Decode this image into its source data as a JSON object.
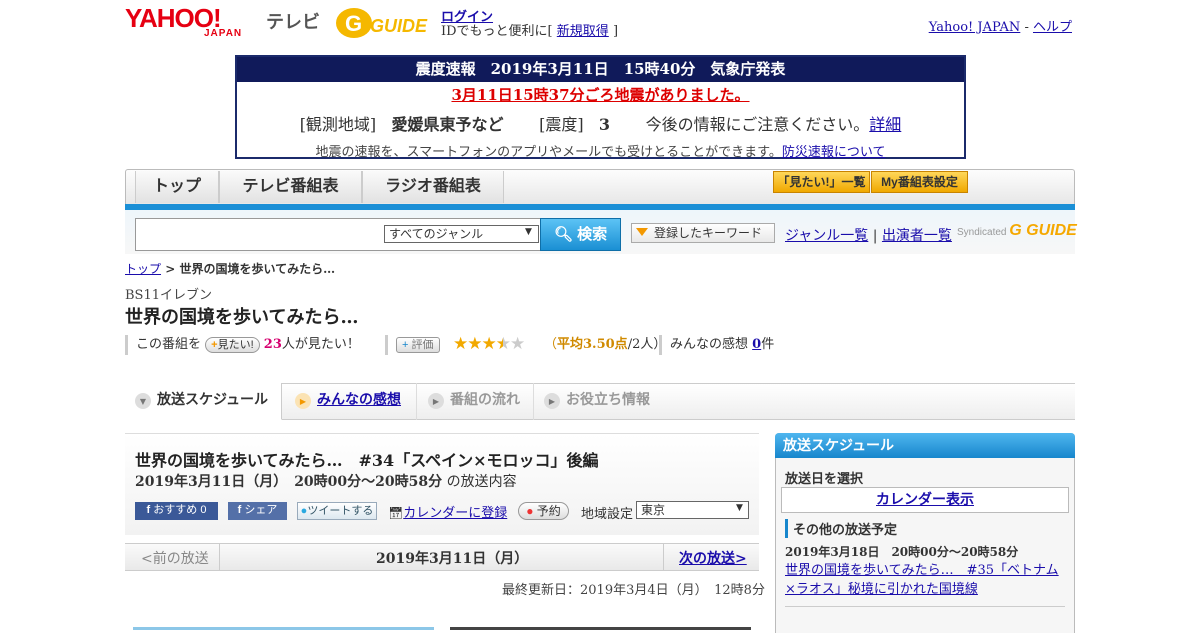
{
  "header": {
    "logo_text": "YAHOO!",
    "logo_sub": "JAPAN",
    "tv_label": "テレビ",
    "gguide_logo": "G GUIDE",
    "login": "ログイン",
    "id_text": "IDでもっと便利に[",
    "signup": "新規取得",
    "id_close": "]",
    "yahoo_japan_link": "Yahoo! JAPAN",
    "sep": " - ",
    "help": "ヘルプ"
  },
  "earthquake": {
    "headline": "震度速報　2019年3月11日　15時40分　気象庁発表",
    "alert": "3月11日15時37分ごろ地震がありました。",
    "region_label": "[観測地域]",
    "region": "愛媛県東予など",
    "intensity_label": "[震度]",
    "intensity": "3",
    "notice": "今後の情報にご注意ください。",
    "detail_link": "詳細",
    "note": "地震の速報を、スマートフォンのアプリやメールでも受けとることができます。",
    "note_link": "防災速報について"
  },
  "nav": {
    "tabs": [
      "トップ",
      "テレビ番組表",
      "ラジオ番組表"
    ],
    "want_list": "「見たい!」一覧",
    "my_schedule": "My番組表設定"
  },
  "search": {
    "genre_selected": "すべてのジャンル",
    "search_button": "検索",
    "keyword_button": "登録したキーワード",
    "genre_list": "ジャンル一覧",
    "divider": "|",
    "performer_list": "出演者一覧",
    "syndicated": "Syndicated",
    "syndicated_logo": "G GUIDE"
  },
  "breadcrumb": {
    "top": "トップ",
    "sep": " > ",
    "current": "世界の国境を歩いてみたら…"
  },
  "program": {
    "channel": "BS11イレブン",
    "title": "世界の国境を歩いてみたら…",
    "prefix": "この番組を",
    "want_button": "見たい!",
    "want_count": "23",
    "want_suffix": "人が見たい！",
    "rate_button": "評価",
    "stars": "★★★★★",
    "avg_open": "（",
    "avg": "平均3.50点",
    "avg_people": "/2人）",
    "opinion_label": "みんなの感想",
    "opinion_count": "0",
    "opinion_unit": "件"
  },
  "tabs": [
    {
      "label": "放送スケジュール"
    },
    {
      "label": "みんなの感想"
    },
    {
      "label": "番組の流れ"
    },
    {
      "label": "お役立ち情報"
    }
  ],
  "episode": {
    "title": "世界の国境を歩いてみたら…　#34「スペイン×モロッコ」後編",
    "datetime": "2019年3月11日（月）　20時00分～20時58分",
    "datetime_suffix": "の放送内容",
    "recommend": "おすすめ 0",
    "share": "シェア",
    "tweet": "ツイートする",
    "calendar": "カレンダーに登録",
    "reserve": "予約",
    "region_label": "地域設定",
    "region": "東京"
  },
  "pager": {
    "prev": "<前の放送",
    "date": "2019年3月11日（月）",
    "next": "次の放送>"
  },
  "updated": "最終更新日：2019年3月4日（月）　12時8分",
  "side": {
    "header": "放送スケジュール",
    "select_date": "放送日を選択",
    "calendar": "カレンダー表示",
    "other": "その他の放送予定",
    "next_date": "2019年3月18日　20時00分～20時58分",
    "next_prog": "世界の国境を歩いてみたら…　#35「ベトナム×ラオス」秘境に引かれた国境線"
  },
  "colors": {
    "brand_red": "#e60012",
    "accent_blue": "#1786cc",
    "eq_navy": "#101a5a",
    "star": "#f2a900",
    "link": "#1a0dab"
  },
  "rating": {
    "average": 3.5,
    "max": 5
  }
}
